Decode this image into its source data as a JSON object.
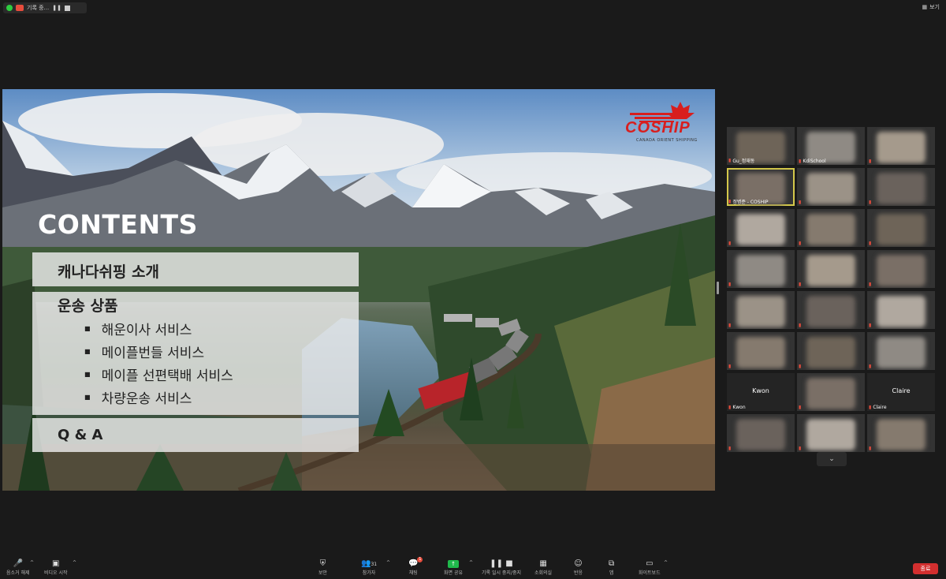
{
  "topbar": {
    "recording_label": "기록 중...",
    "view_label": "보기"
  },
  "slide": {
    "logo_text": "COSHIP",
    "logo_sub": "CANADA ORIENT SHIPPING",
    "title": "CONTENTS",
    "section1": "캐나다쉬핑 소개",
    "section2": "운송 상품",
    "items": [
      "해운이사 서비스",
      "메이플번들 서비스",
      "메이플 선편택배 서비스",
      "차량운송 서비스"
    ],
    "section3": "Q & A"
  },
  "gallery": {
    "tiles": [
      {
        "name": "Gu_정재동"
      },
      {
        "name": "KdiSchool"
      },
      {
        "name": ""
      },
      {
        "name": "정병준 - COSHIP"
      },
      {
        "name": ""
      },
      {
        "name": ""
      },
      {
        "name": ""
      },
      {
        "name": ""
      },
      {
        "name": ""
      },
      {
        "name": ""
      },
      {
        "name": ""
      },
      {
        "name": ""
      },
      {
        "name": ""
      },
      {
        "name": ""
      },
      {
        "name": ""
      },
      {
        "name": ""
      },
      {
        "name": ""
      },
      {
        "name": ""
      },
      {
        "name": "Kwon",
        "center": "Kwon"
      },
      {
        "name": ""
      },
      {
        "name": "Claire",
        "center": "Claire"
      },
      {
        "name": ""
      },
      {
        "name": ""
      },
      {
        "name": ""
      }
    ]
  },
  "toolbar": {
    "mute": "음소거 해제",
    "video": "비디오 시작",
    "security": "보안",
    "participants": "참가자",
    "participants_count": "31",
    "chat": "채팅",
    "chat_badge": "1",
    "share": "화면 공유",
    "record": "기록 일시 중지/중지",
    "gallery": "소회의실",
    "reactions": "반응",
    "apps": "앱",
    "whiteboard": "화이트보드",
    "end": "종료"
  }
}
